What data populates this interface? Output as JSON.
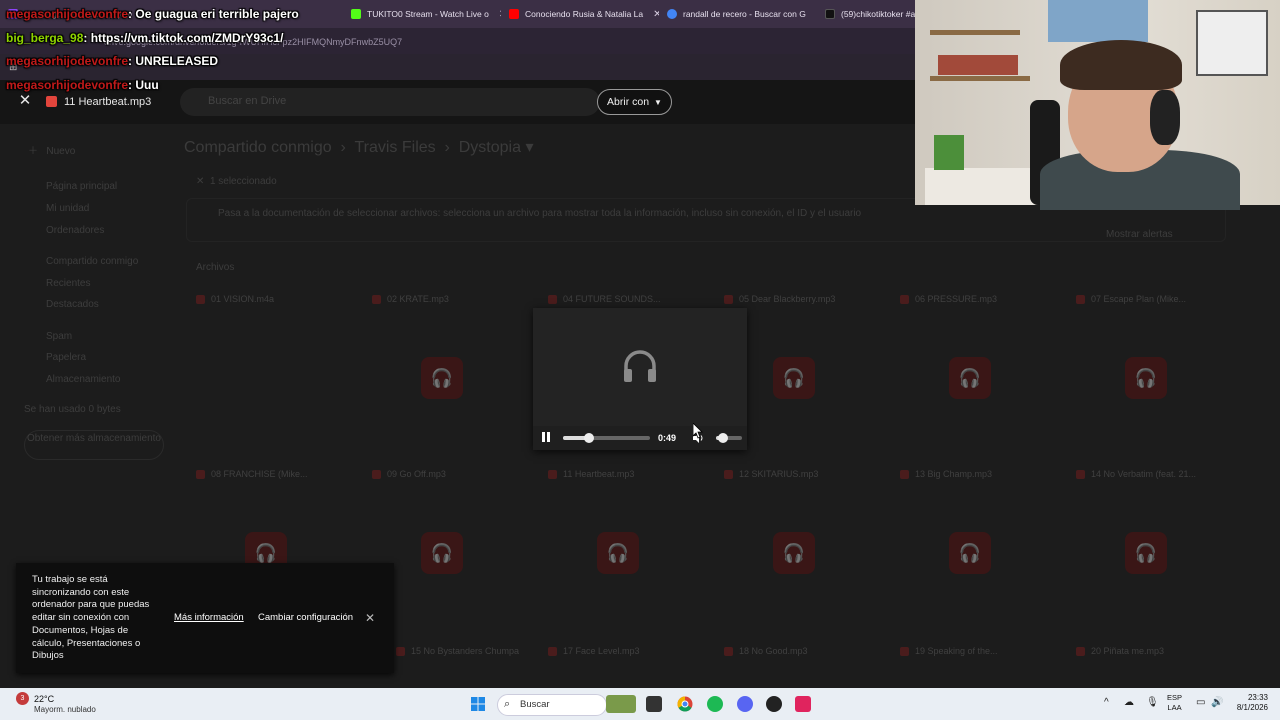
{
  "browser": {
    "tabs": [
      {
        "label": "Oe guagua eri terrible pajero",
        "color": "#9146ff"
      },
      {
        "label": "TUKITO0 Stream - Watch Live o",
        "color": "#53fc18"
      },
      {
        "label": "Conociendo Rusia & Natalia La",
        "color": "#ff0000"
      },
      {
        "label": "randall de recero - Buscar con G",
        "color": "#4285f4"
      },
      {
        "label": "(59)chikotiktoker #an",
        "color": "#111111"
      }
    ],
    "url": "drive.google.com/drive/folders/1g-fWUHfHcFpz2HIFMQNmyDFnwbZ5UQ7"
  },
  "chat": [
    {
      "user": "megasorhijodevonfre",
      "message": ": Oe guagua eri terrible pajero",
      "user_color": "#c01a1a"
    },
    {
      "user": "big_berga_98",
      "message": ": https://vm.tiktok.com/ZMDrY93c1/",
      "user_color": "#8fd400"
    },
    {
      "user": "megasorhijodevonfre",
      "message": ": UNRELEASED",
      "user_color": "#c01a1a"
    },
    {
      "user": "megasorhijodevonfre",
      "message": ": Uuu",
      "user_color": "#c01a1a"
    }
  ],
  "drive": {
    "search_placeholder": "Buscar en Drive",
    "new_button": "Nuevo",
    "sidebar": [
      "Página principal",
      "Mi unidad",
      "Ordenadores",
      "Compartido conmigo",
      "Recientes",
      "Destacados",
      "Spam",
      "Papelera",
      "Almacenamiento"
    ],
    "storage_text": "Se han usado 0 bytes",
    "get_more": "Obtener más almacenamiento",
    "breadcrumb": [
      "Compartido conmigo",
      "Travis Files",
      "Dystopia"
    ],
    "toolbar_filter": "1 seleccionado",
    "notice": "Pasa a la documentación de seleccionar archivos: selecciona un archivo para mostrar toda la información, incluso sin conexión, el ID y el usuario",
    "notice_action": "Mostrar alertas",
    "section_label": "Archivos",
    "files_row1": [
      "01 VISION.m4a",
      "02 KRATE.mp3",
      "04 FUTURE SOUNDS...",
      "05 Dear Blackberry.mp3",
      "06 PRESSURE.mp3",
      "07 Escape Plan (Mike..."
    ],
    "files_row2": [
      "08 FRANCHISE (Mike...",
      "09 Go Off.mp3",
      "11 Heartbeat.mp3",
      "12 SKITARIUS.mp3",
      "13 Big Champ.mp3",
      "14 No Verbatim (feat. 21..."
    ],
    "files_row3": [
      "15 No Bystanders Chumpa",
      "17 Face Level.mp3",
      "18 No Good.mp3",
      "19 Speaking of the...",
      "20 Piñata me.mp3"
    ]
  },
  "viewer": {
    "filename": "11 Heartbeat.mp3",
    "open_with": "Abrir con",
    "time": "0:49",
    "progress": 0.3,
    "volume": 0.2
  },
  "snackbar": {
    "message": "Tu trabajo se está sincronizando con este ordenador para que puedas editar sin conexión con Documentos, Hojas de cálculo, Presentaciones o Dibujos",
    "more_info": "Más información",
    "change_settings": "Cambiar configuración"
  },
  "taskbar": {
    "weather_badge": "3",
    "temperature": "22°C",
    "weather": "Mayorm. nublado",
    "search": "Buscar",
    "lang_line1": "ESP",
    "lang_line2": "LAA",
    "time": "23:33",
    "date": "8/1/2026"
  }
}
